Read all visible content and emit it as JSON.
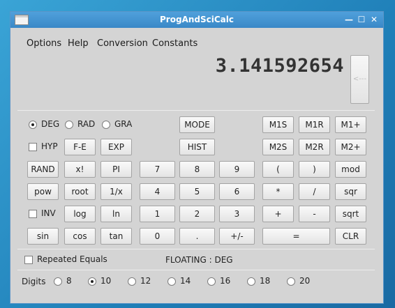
{
  "window": {
    "title": "ProgAndSciCalc",
    "minimize": "—",
    "maximize": "☐",
    "close": "✕"
  },
  "menu": {
    "options": "Options",
    "help": "Help",
    "conversion": "Conversion",
    "constants": "Constants"
  },
  "display": {
    "value": "3.141592654",
    "backspace": "<---"
  },
  "angle_mode": {
    "deg": "DEG",
    "rad": "RAD",
    "gra": "GRA",
    "selected": "DEG"
  },
  "toggles": {
    "hyp": "HYP",
    "inv": "INV",
    "repeated_equals": "Repeated Equals"
  },
  "keys": {
    "mode": "MODE",
    "hist": "HIST",
    "m1s": "M1S",
    "m1r": "M1R",
    "m1plus": "M1+",
    "m2s": "M2S",
    "m2r": "M2R",
    "m2plus": "M2+",
    "fe": "F-E",
    "exp": "EXP",
    "rand": "RAND",
    "fact": "x!",
    "pi": "PI",
    "pow": "pow",
    "root": "root",
    "recip": "1/x",
    "log": "log",
    "ln": "ln",
    "sin": "sin",
    "cos": "cos",
    "tan": "tan",
    "d7": "7",
    "d8": "8",
    "d9": "9",
    "d4": "4",
    "d5": "5",
    "d6": "6",
    "d1": "1",
    "d2": "2",
    "d3": "3",
    "d0": "0",
    "dot": ".",
    "neg": "+/-",
    "lparen": "(",
    "rparen": ")",
    "mod": "mod",
    "mul": "*",
    "div": "/",
    "sqr": "sqr",
    "add": "+",
    "sub": "-",
    "sqrt": "sqrt",
    "equals": "=",
    "clr": "CLR"
  },
  "status": "FLOATING : DEG",
  "digits": {
    "label": "Digits",
    "options": [
      "8",
      "10",
      "12",
      "14",
      "16",
      "18",
      "20"
    ],
    "selected": "10"
  }
}
